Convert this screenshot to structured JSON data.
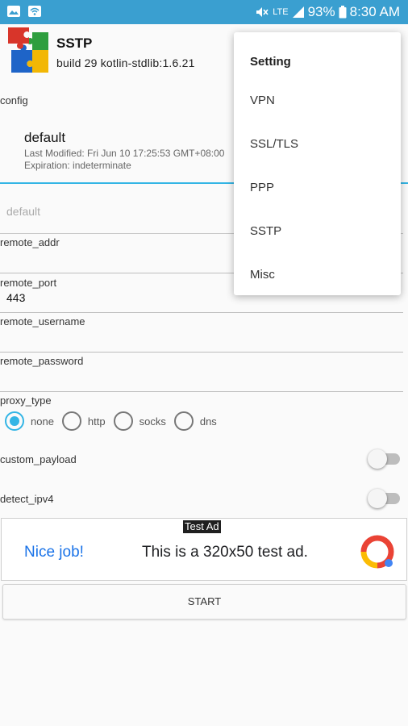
{
  "status": {
    "signal": "LTE",
    "battery": "93%",
    "time": "8:30 AM"
  },
  "app": {
    "title": "SSTP",
    "build": "build 29 kotlin-stdlib:1.6.21"
  },
  "config": {
    "section_label": "config",
    "name": "default",
    "last_modified": "Last Modified: Fri Jun 10 17:25:53 GMT+08:00",
    "expiration": "Expiration: indeterminate"
  },
  "spinner": {
    "value": "default"
  },
  "fields": {
    "remote_addr": {
      "label": "remote_addr",
      "value": ""
    },
    "remote_port": {
      "label": "remote_port",
      "value": "443"
    },
    "remote_username": {
      "label": "remote_username",
      "value": ""
    },
    "remote_password": {
      "label": "remote_password",
      "value": ""
    }
  },
  "proxy": {
    "label": "proxy_type",
    "options": [
      "none",
      "http",
      "socks",
      "dns"
    ],
    "selected": "none"
  },
  "toggles": {
    "custom_payload": {
      "label": "custom_payload",
      "on": false
    },
    "detect_ipv4": {
      "label": "detect_ipv4",
      "on": false
    }
  },
  "ad": {
    "badge": "Test Ad",
    "left_text": "Nice job!",
    "main_text": "This is a 320x50 test ad."
  },
  "start_label": "START",
  "menu": {
    "title": "Setting",
    "items": [
      "VPN",
      "SSL/TLS",
      "PPP",
      "SSTP",
      "Misc"
    ]
  },
  "colors": {
    "status_bar": "#3a9fd0",
    "accent": "#33b5e5",
    "ad_link": "#1a73e8"
  }
}
